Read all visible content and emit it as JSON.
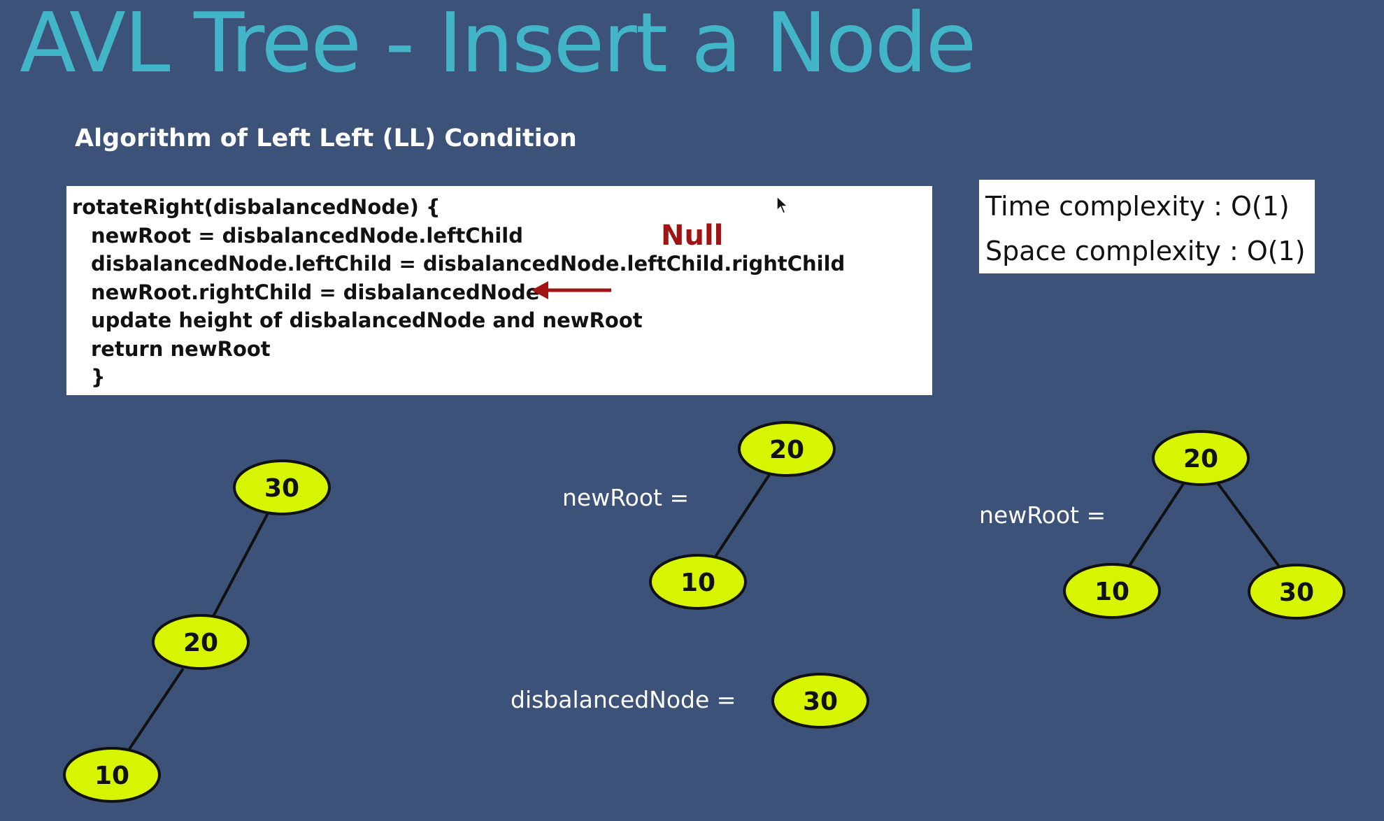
{
  "title": "AVL Tree - Insert a Node",
  "subtitle": "Algorithm of Left Left (LL) Condition",
  "code": {
    "lines": [
      "rotateRight(disbalancedNode) {",
      "newRoot = disbalancedNode.leftChild",
      "disbalancedNode.leftChild = disbalancedNode.leftChild.rightChild",
      "newRoot.rightChild = disbalancedNode",
      "update height of disbalancedNode and newRoot",
      "return newRoot",
      "}"
    ]
  },
  "annotation": {
    "text": "Null",
    "color": "#a01414"
  },
  "complexity": {
    "time": "Time complexity : O(1)",
    "space": "Space complexity : O(1)"
  },
  "labels": {
    "new_root_1": "newRoot =",
    "disbalanced": "disbalancedNode =",
    "new_root_2": "newRoot ="
  },
  "trees": {
    "original": {
      "root": "30",
      "left": "20",
      "left_left": "10"
    },
    "intermediate": {
      "root": "20",
      "left": "10"
    },
    "disbalanced": {
      "root": "30"
    },
    "rotated": {
      "root": "20",
      "left": "10",
      "right": "30"
    }
  },
  "colors": {
    "background": "#3c5278",
    "title": "#43b5c9",
    "node_fill": "#d7f500",
    "node_stroke": "#111111",
    "arrow": "#a01414"
  }
}
